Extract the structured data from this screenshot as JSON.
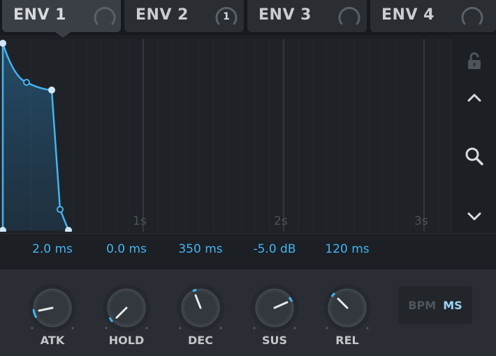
{
  "tabs": [
    {
      "label": "ENV 1",
      "badge": ""
    },
    {
      "label": "ENV 2",
      "badge": "1"
    },
    {
      "label": "ENV 3",
      "badge": ""
    },
    {
      "label": "ENV 4",
      "badge": ""
    }
  ],
  "graph": {
    "time_labels": [
      "1s",
      "2s",
      "3s"
    ]
  },
  "values": {
    "attack": "2.0 ms",
    "hold": "0.0 ms",
    "decay": "350 ms",
    "sustain": "-5.0 dB",
    "release": "120 ms"
  },
  "knobs": {
    "atk": "ATK",
    "hold": "HOLD",
    "dec": "DEC",
    "sus": "SUS",
    "rel": "REL"
  },
  "mode": {
    "bpm": "BPM",
    "ms": "MS"
  },
  "colors": {
    "accent": "#44b4f0",
    "background": "#1c1f24",
    "panel": "#2a2e34"
  }
}
